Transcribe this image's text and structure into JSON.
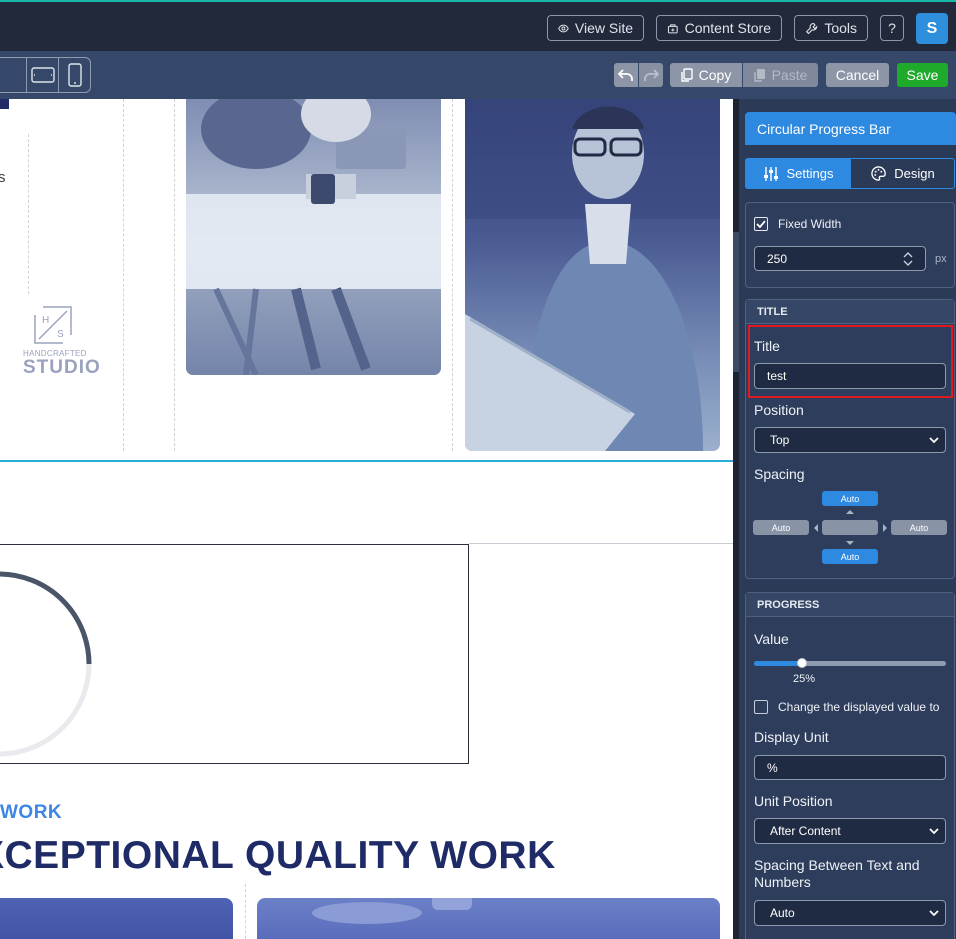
{
  "topbar": {
    "view_site": "View Site",
    "content_store": "Content Store",
    "tools": "Tools",
    "help": "?",
    "avatar_initial": "S"
  },
  "toolbar": {
    "copy": "Copy",
    "paste": "Paste",
    "cancel": "Cancel",
    "save": "Save"
  },
  "canvas": {
    "partial_text": "s",
    "logo_letters": "H S",
    "logo_line1": "HANDCRAFTED",
    "logo_line2": "STUDIO",
    "eyebrow": "WORK",
    "headline": "XCEPTIONAL QUALITY WORK"
  },
  "panel": {
    "header": "Circular Progress Bar",
    "tabs": [
      "Settings",
      "Design"
    ],
    "fixed_width_label": "Fixed Width",
    "fixed_width_checked": true,
    "width_value": "250",
    "width_unit": "px",
    "title_section": {
      "heading": "TITLE",
      "title_label": "Title",
      "title_value": "test",
      "position_label": "Position",
      "position_value": "Top",
      "spacing_label": "Spacing",
      "spacing_top": "Auto",
      "spacing_left": "Auto",
      "spacing_right": "Auto",
      "spacing_bottom": "Auto"
    },
    "progress_section": {
      "heading": "PROGRESS",
      "value_label": "Value",
      "value_percent": 25,
      "value_text": "25%",
      "change_display_label": "Change the displayed value to",
      "display_unit_label": "Display Unit",
      "display_unit_value": "%",
      "unit_position_label": "Unit Position",
      "unit_position_value": "After Content",
      "spacing_text_label": "Spacing Between Text and Numbers",
      "spacing_text_value": "Auto"
    }
  },
  "colors": {
    "accent": "#2e89e0",
    "save": "#1faa2c",
    "highlight": "#e01a22",
    "headline": "#1e2b66"
  }
}
